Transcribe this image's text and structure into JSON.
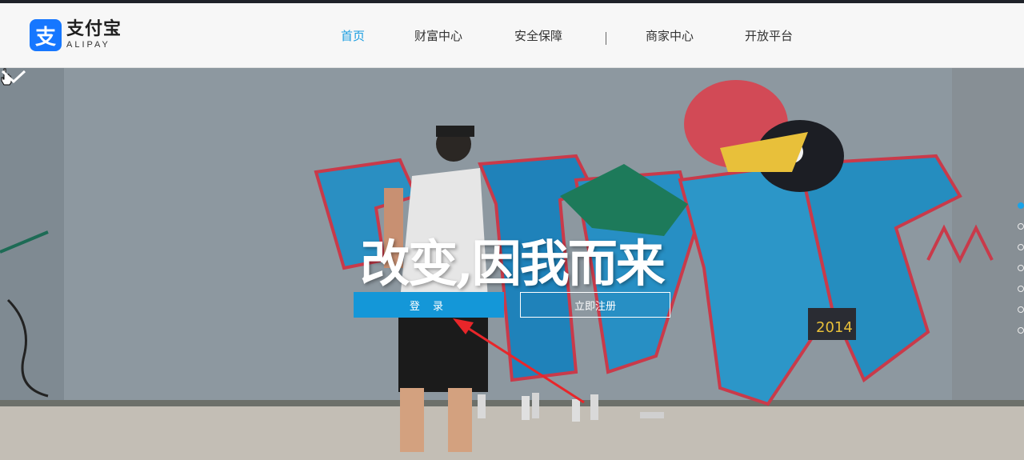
{
  "header": {
    "logo": {
      "cn": "支付宝",
      "en": "ALIPAY",
      "icon": "alipay-logo-icon"
    },
    "nav": [
      {
        "label": "首页",
        "active": true
      },
      {
        "label": "财富中心",
        "active": false
      },
      {
        "label": "安全保障",
        "active": false
      },
      {
        "label": "商家中心",
        "active": false
      },
      {
        "label": "开放平台",
        "active": false
      }
    ]
  },
  "hero": {
    "slogan": "改变,因我而来",
    "login_label": "登 录",
    "register_label": "立即注册",
    "scroll_icon": "chevron-down-icon",
    "carousel": {
      "count": 7,
      "active_index": 0
    }
  },
  "colors": {
    "accent": "#1497d8",
    "nav_active": "#1a9de0",
    "annotation_arrow": "#e8262a"
  }
}
